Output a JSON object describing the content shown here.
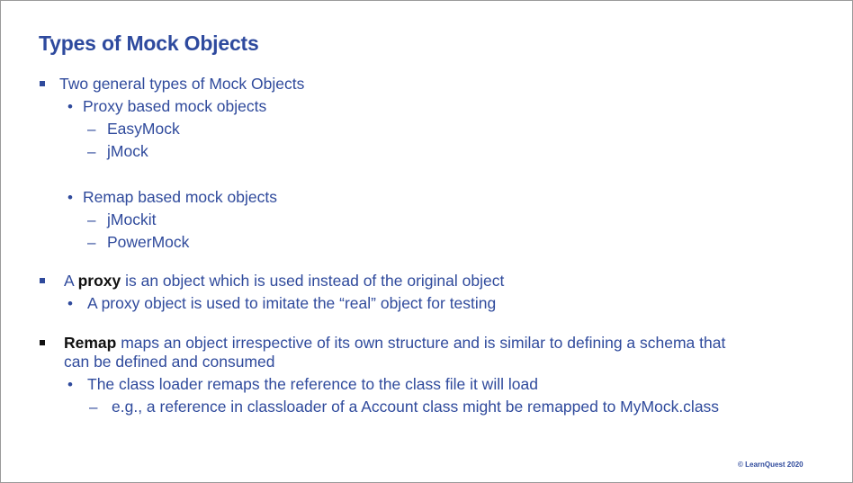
{
  "title": "Types of Mock Objects",
  "items": {
    "l1": "Two general types of Mock Objects",
    "l2": "Proxy based mock objects",
    "l3": "EasyMock",
    "l4": "jMock",
    "l5": "Remap based mock objects",
    "l6": "jMockit",
    "l7": "PowerMock",
    "l8_pre": "A ",
    "l8_bold": "proxy",
    "l8_post": " is an object which is used instead of the original object",
    "l9": "A proxy object is used to imitate the “real” object for testing",
    "l10_bold": "Remap",
    "l10_post": " maps an object irrespective of its own structure and is similar to defining a schema that",
    "l10_cont": "can be defined and consumed",
    "l11": "The class loader remaps the reference to the class file it will load",
    "l12": "e.g., a reference in classloader of a Account class might be remapped to MyMock.class"
  },
  "markers": {
    "dot": "•",
    "dash": "–"
  },
  "footer": "© LearnQuest 2020"
}
